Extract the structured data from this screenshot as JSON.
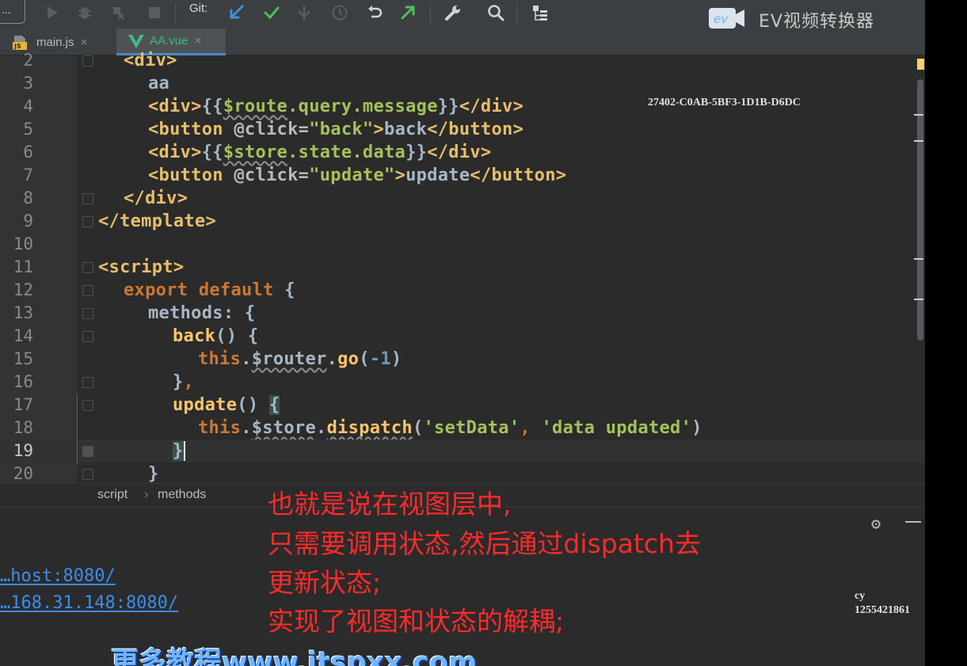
{
  "toolbar": {
    "project_button": "...",
    "git_label": "Git:"
  },
  "overlay": {
    "ev_logo_text": "ev",
    "ev_title": "EV视频转换器",
    "watermark_code": "27402-C0AB-5BF3-1D1B-D6DC",
    "cy_name": "cy",
    "cy_number": "1255421861",
    "site_watermark": "更多教程www.itspxx.com"
  },
  "tabs": [
    {
      "label": "main.js",
      "icon": "js-file-icon",
      "active": false
    },
    {
      "label": "AA.vue",
      "icon": "vue-file-icon",
      "active": true
    }
  ],
  "editor": {
    "current_line": "19",
    "lines": [
      {
        "n": "2",
        "text": "<div>"
      },
      {
        "n": "3",
        "text": "aa"
      },
      {
        "n": "4",
        "text": "<div>{{$route.query.message}}</div>"
      },
      {
        "n": "5",
        "text": "<button @click=\"back\">back</button>"
      },
      {
        "n": "6",
        "text": "<div>{{$store.state.data}}</div>"
      },
      {
        "n": "7",
        "text": "<button @click=\"update\">update</button>"
      },
      {
        "n": "8",
        "text": "</div>"
      },
      {
        "n": "9",
        "text": "</template>"
      },
      {
        "n": "10",
        "text": ""
      },
      {
        "n": "11",
        "text": "<script>"
      },
      {
        "n": "12",
        "text": "export default {"
      },
      {
        "n": "13",
        "text": "methods: {"
      },
      {
        "n": "14",
        "text": "back() {"
      },
      {
        "n": "15",
        "text": "this.$router.go(-1)"
      },
      {
        "n": "16",
        "text": "},"
      },
      {
        "n": "17",
        "text": "update() {"
      },
      {
        "n": "18",
        "text": "this.$store.dispatch('setData', 'data updated')"
      },
      {
        "n": "19",
        "text": "}"
      },
      {
        "n": "20",
        "text": "}"
      }
    ]
  },
  "breadcrumb": [
    "script",
    "methods"
  ],
  "terminal": {
    "url_local": "…host:8080/",
    "url_network": "…168.31.148:8080/"
  },
  "subtitles": [
    "也就是说在视图层中,",
    "只需要调用状态,然后通过dispatch去",
    "更新状态;",
    "实现了视图和状态的解耦;"
  ],
  "colors": {
    "ide_bg": "#2b2b2b",
    "toolbar_bg": "#3c3f41",
    "tag": "#e8bf6a",
    "string": "#a5c25c",
    "keyword": "#cc7832",
    "function": "#ffc66d",
    "number": "#6897bb",
    "link": "#3b8eea",
    "subtitle": "#ff2a2a"
  }
}
